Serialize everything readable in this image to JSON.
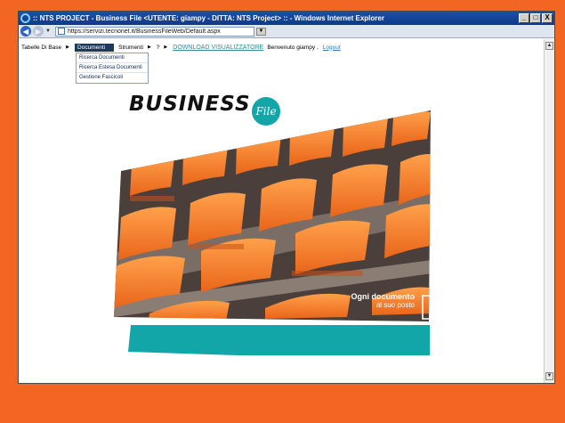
{
  "window": {
    "title": "NTS PROJECT - Business File <UTENTE: giampy - DITTA: NTS Project> :: - Windows Internet Explorer",
    "title_prefix": ":: ",
    "buttons": [
      "_",
      "□",
      "X"
    ]
  },
  "address": {
    "url": "https://servizi.tecnonet.it/BusinessFileWeb/Default.aspx"
  },
  "menu": {
    "tabelle": "Tabelle Di Base",
    "documenti": "Documenti",
    "strumenti": "Strumenti",
    "help": "?",
    "download": "DOWNLOAD VISUALIZZATORE",
    "welcome": "Benvenuto giampy ,",
    "logout": "Logout",
    "dropdown": [
      "Ricerca Documenti",
      "Ricerca Estesa Documenti",
      "Gestione Fascicoli"
    ]
  },
  "brand": {
    "name": "BUSINESS",
    "file": "File"
  },
  "banner": {
    "line1": "Ogni documento",
    "line2": "al suo posto"
  },
  "colors": {
    "frame": "#f26522",
    "teal": "#13a6a8",
    "seat_orange": "#f5822a"
  },
  "icons": [
    "ie-logo-icon",
    "back-arrow-icon",
    "forward-arrow-icon",
    "page-icon",
    "document-icon",
    "scroll-up-icon",
    "scroll-down-icon"
  ]
}
